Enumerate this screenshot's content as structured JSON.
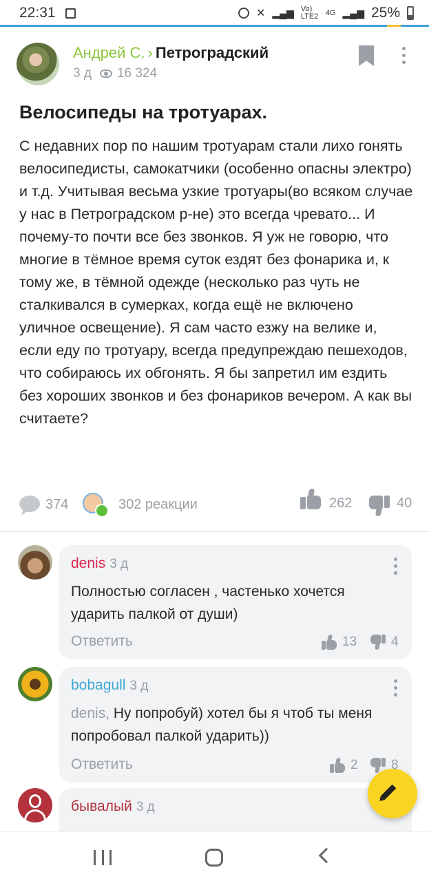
{
  "status_bar": {
    "time": "22:31",
    "network_label": "Vo) LTE2",
    "network_type": "4G",
    "battery": "25%"
  },
  "post": {
    "author": "Андрей С.",
    "separator": "›",
    "district": "Петроградский",
    "age": "3 д",
    "views": "16 324",
    "title": "Велосипеды на тротуарах.",
    "body": "С недавних пор по нашим тротуарам стали лихо гонять велосипедисты, самокатчики (особенно опасны электро) и т.д. Учитывая весьма узкие тротуары(во всяком случае у нас в Петроградском р-не) это всегда чревато... И почему-то почти все без звонков. Я уж не говорю, что многие в тёмное время суток ездят без фонарика и, к тому же, в тёмной одежде (несколько раз чуть не сталкивался в сумерках, когда ещё не включено уличное освещение). Я сам часто езжу на велике и, если еду по тротуару, всегда предупреждаю пешеходов, что собираюсь их обгонять. Я бы запретил им ездить без хороших звонков и без фонариков вечером. А как вы считаете?",
    "comments_count": "374",
    "reactions_label": "302 реакции",
    "likes": "262",
    "dislikes": "40"
  },
  "comments": [
    {
      "author": "denis",
      "age": "3 д",
      "text": "Полностью согласен , частенько хочется ударить палкой от души)",
      "reply_label": "Ответить",
      "likes": "13",
      "dislikes": "4"
    },
    {
      "author": "bobagull",
      "age": "3 д",
      "mention": "denis,",
      "text": " Ну попробуй) хотел бы я чтоб ты меня попробовал палкой ударить))",
      "reply_label": "Ответить",
      "likes": "2",
      "dislikes": "8"
    },
    {
      "author": "бывалый",
      "age": "3 д"
    }
  ],
  "colors": {
    "accent_green": "#8cc63f",
    "fab_yellow": "#f9d423",
    "denis_red": "#d9294e",
    "bobagull_blue": "#3fa8d4",
    "byvaly_red": "#b3323c"
  }
}
